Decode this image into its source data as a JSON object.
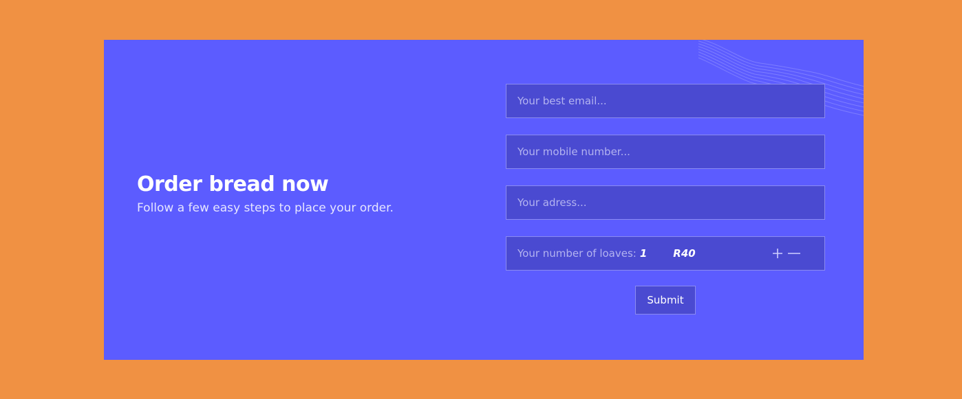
{
  "hero": {
    "title": "Order bread now",
    "subtitle": "Follow a few easy steps to place your order."
  },
  "form": {
    "email_placeholder": "Your best email...",
    "mobile_placeholder": "Your mobile number...",
    "address_placeholder": "Your adress...",
    "loaves_label": "Your number of loaves:",
    "loaves_count": "1",
    "price": "R40",
    "submit_label": "Submit"
  },
  "icons": {
    "increment": "plus-icon",
    "decrement": "minus-icon"
  },
  "colors": {
    "page_background": "#F09143",
    "card_background": "#5C5CFF",
    "field_background": "#4A4AD1",
    "field_border": "#8B8BF0",
    "text": "#FFFFFF"
  }
}
